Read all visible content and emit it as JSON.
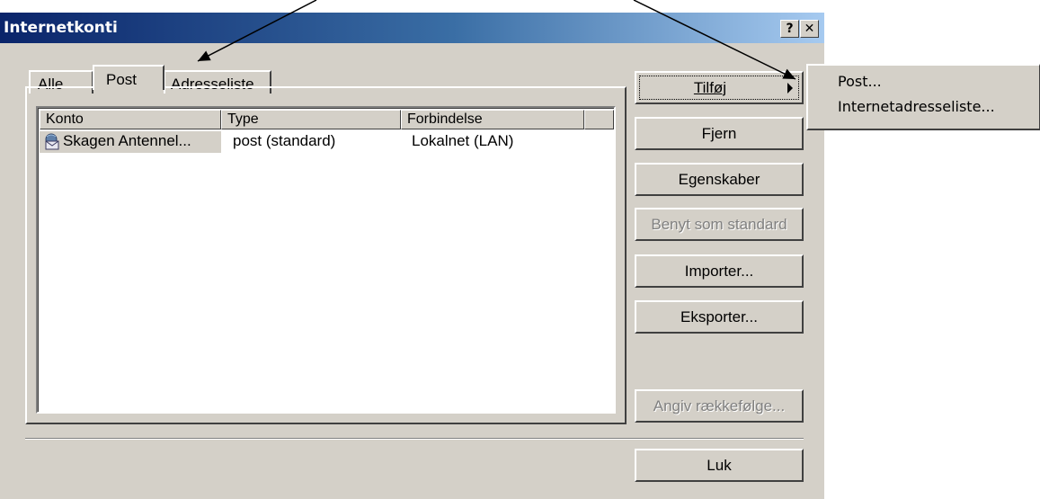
{
  "window": {
    "title": "Internetkonti",
    "help_label": "?",
    "close_label": "✕"
  },
  "tabs": [
    {
      "label": "Alle"
    },
    {
      "label": "Post"
    },
    {
      "label": "Adresseliste"
    }
  ],
  "list": {
    "columns": [
      "Konto",
      "Type",
      "Forbindelse"
    ],
    "rows": [
      {
        "konto": "Skagen Antennel...",
        "type": "post (standard)",
        "forbindelse": "Lokalnet (LAN)",
        "icon": "mail-account-icon"
      }
    ]
  },
  "buttons": {
    "tilfoj": "Tilføj",
    "fjern": "Fjern",
    "egenskaber": "Egenskaber",
    "benyt": "Benyt som standard",
    "importer": "Importer...",
    "eksporter": "Eksporter...",
    "angiv": "Angiv rækkefølge...",
    "luk": "Luk"
  },
  "menu": {
    "items": [
      "Post...",
      "Internetadresseliste..."
    ]
  },
  "colors": {
    "face": "#d4d0c8",
    "title_start": "#0a246a",
    "title_end": "#a6caf0",
    "disabled_text": "#808080"
  }
}
